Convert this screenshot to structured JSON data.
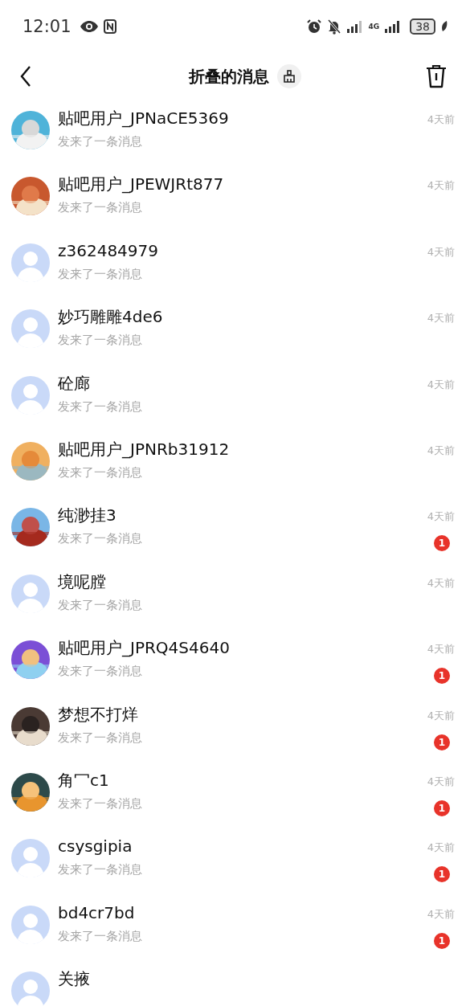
{
  "status_bar": {
    "time": "12:01",
    "network": "4G",
    "battery": "38"
  },
  "header": {
    "title": "折叠的消息"
  },
  "messages": [
    {
      "name": "贴吧用户_JPNaCE5369",
      "preview": "发来了一条消息",
      "time": "4天前",
      "kind": "picture"
    },
    {
      "name": "贴吧用户_JPEWJRt877",
      "preview": "发来了一条消息",
      "time": "4天前",
      "kind": "picture"
    },
    {
      "name": "z362484979",
      "preview": "发来了一条消息",
      "time": "4天前",
      "kind": "default"
    },
    {
      "name": "妙巧雕雕4de6",
      "preview": "发来了一条消息",
      "time": "4天前",
      "kind": "default"
    },
    {
      "name": "砼廊",
      "preview": "发来了一条消息",
      "time": "4天前",
      "kind": "default"
    },
    {
      "name": "贴吧用户_JPNRb31912",
      "preview": "发来了一条消息",
      "time": "4天前",
      "kind": "picture"
    },
    {
      "name": "纯渺挂3",
      "preview": "发来了一条消息",
      "time": "4天前",
      "kind": "picture",
      "unread": "1"
    },
    {
      "name": "境呢膛",
      "preview": "发来了一条消息",
      "time": "4天前",
      "kind": "default"
    },
    {
      "name": "贴吧用户_JPRQ4S4640",
      "preview": "发来了一条消息",
      "time": "4天前",
      "kind": "picture",
      "unread": "1"
    },
    {
      "name": "梦想不打烊",
      "preview": "发来了一条消息",
      "time": "4天前",
      "kind": "picture",
      "unread": "1"
    },
    {
      "name": "角冖c1",
      "preview": "发来了一条消息",
      "time": "4天前",
      "kind": "picture",
      "unread": "1"
    },
    {
      "name": "csysgipia",
      "preview": "发来了一条消息",
      "time": "4天前",
      "kind": "default",
      "unread": "1"
    },
    {
      "name": "bd4cr7bd",
      "preview": "发来了一条消息",
      "time": "4天前",
      "kind": "default",
      "unread": "1"
    },
    {
      "name": "关掖",
      "kind": "default"
    }
  ]
}
